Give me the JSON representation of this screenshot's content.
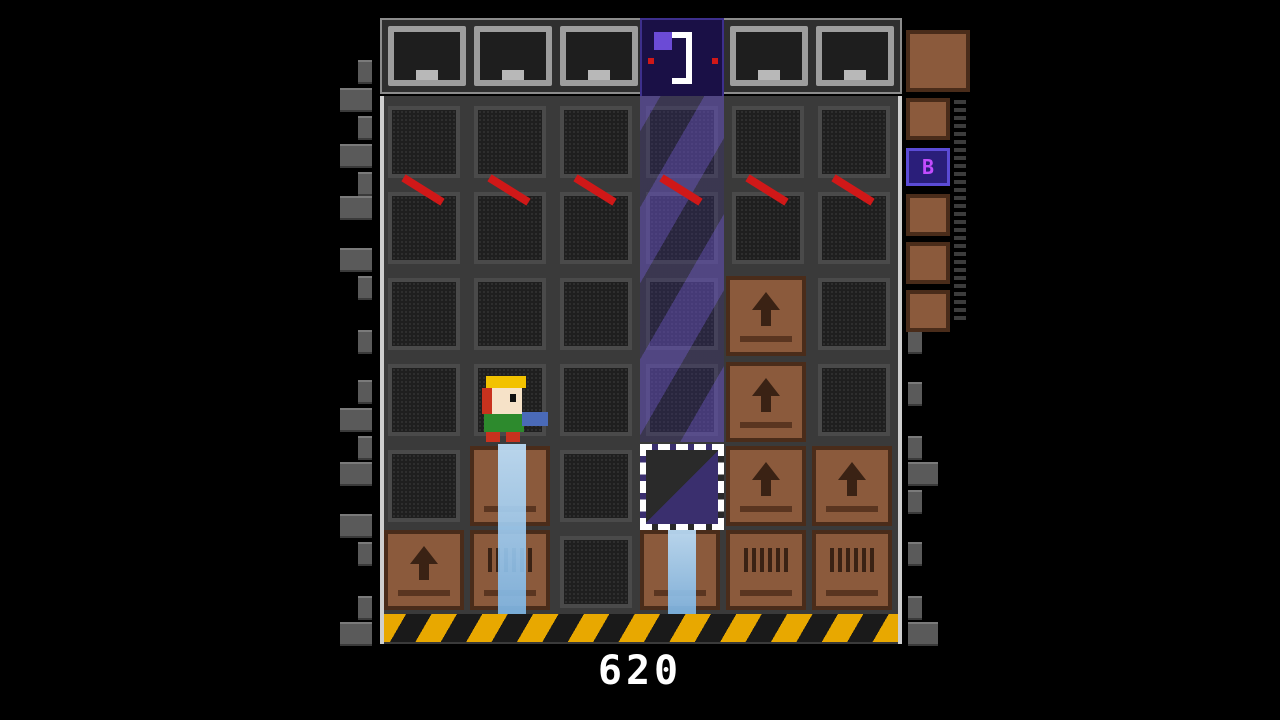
{
  "game": {
    "score": "620",
    "colors": {
      "background": "#000000",
      "crate": "#8b5a3c",
      "laser": "#d01818",
      "hazard_yellow": "#e8a800",
      "beam_purple": "#6450be",
      "bomb": "#2a1e7a"
    }
  },
  "hud": {
    "next_queue": [
      "crate",
      "crate",
      "bomb",
      "crate",
      "crate",
      "crate"
    ]
  },
  "board": {
    "columns": 6,
    "rows": 6
  },
  "icons": {
    "player": "player-character-icon",
    "bomb": "bomb-block-icon",
    "crate_arrow": "up-arrow-icon",
    "barcode": "barcode-icon"
  }
}
